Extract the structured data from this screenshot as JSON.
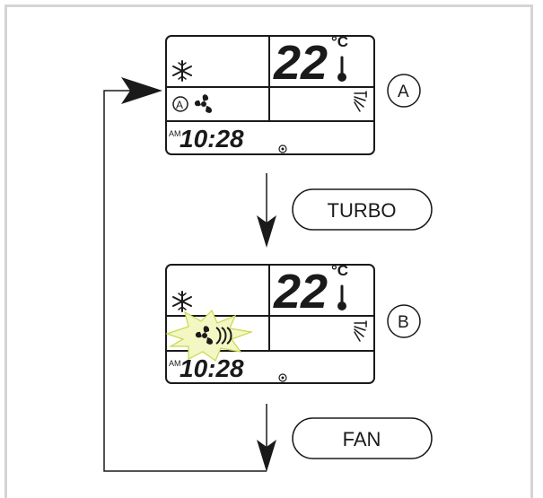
{
  "diagram": {
    "panel_a": {
      "temperature": "22",
      "temp_unit": "°C",
      "clock_ampm": "AM",
      "clock_time": "10:28",
      "label": "A",
      "icons": [
        "snowflake-icon",
        "auto-icon",
        "fan-icon",
        "thermometer-icon",
        "swing-icon",
        "dot-icon"
      ]
    },
    "panel_b": {
      "temperature": "22",
      "temp_unit": "°C",
      "clock_ampm": "AM",
      "clock_time": "10:28",
      "label": "B",
      "icons": [
        "snowflake-icon",
        "turbo-fan-icon",
        "flash-burst-icon",
        "thermometer-icon",
        "swing-icon",
        "dot-icon"
      ]
    },
    "buttons": {
      "turbo": "TURBO",
      "fan": "FAN"
    },
    "colors": {
      "stroke": "#1a1a1a",
      "burst_fill": "#f3f7c4",
      "burst_stroke": "#c8d84a",
      "frame": "#d4d4d4"
    }
  }
}
